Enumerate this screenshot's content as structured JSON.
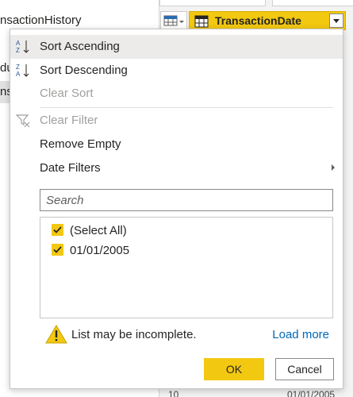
{
  "background": {
    "queries": [
      {
        "label": "nsactionHistory",
        "selected": false
      },
      {
        "label": "du",
        "selected": false
      },
      {
        "label": "du",
        "selected": false
      },
      {
        "label": "nsa",
        "selected": true
      }
    ],
    "column": {
      "name": "TransactionDate"
    },
    "bottom_row": {
      "index": "10",
      "value": "01/01/2005"
    }
  },
  "menu": {
    "items": [
      {
        "label": "Sort Ascending",
        "icon": "sort-ascending-icon",
        "disabled": false,
        "hover": true
      },
      {
        "label": "Sort Descending",
        "icon": "sort-descending-icon",
        "disabled": false
      },
      {
        "label": "Clear Sort",
        "icon": "",
        "disabled": true
      },
      {
        "label": "Clear Filter",
        "icon": "clear-filter-icon",
        "disabled": true
      },
      {
        "label": "Remove Empty",
        "icon": "",
        "disabled": false
      },
      {
        "label": "Date Filters",
        "icon": "",
        "disabled": false,
        "submenu": true
      }
    ],
    "search": {
      "placeholder": "Search",
      "value": ""
    },
    "list": [
      {
        "label": "(Select All)",
        "checked": true
      },
      {
        "label": "01/01/2005",
        "checked": true
      }
    ],
    "warning": {
      "icon": "warning-icon",
      "text": "List may be incomplete."
    },
    "load_more": "Load more",
    "ok_label": "OK",
    "cancel_label": "Cancel"
  },
  "colors": {
    "accent": "#f2c811",
    "link": "#0067b8",
    "disabled_text": "#a19f9d",
    "hover_bg": "#edebe9"
  }
}
